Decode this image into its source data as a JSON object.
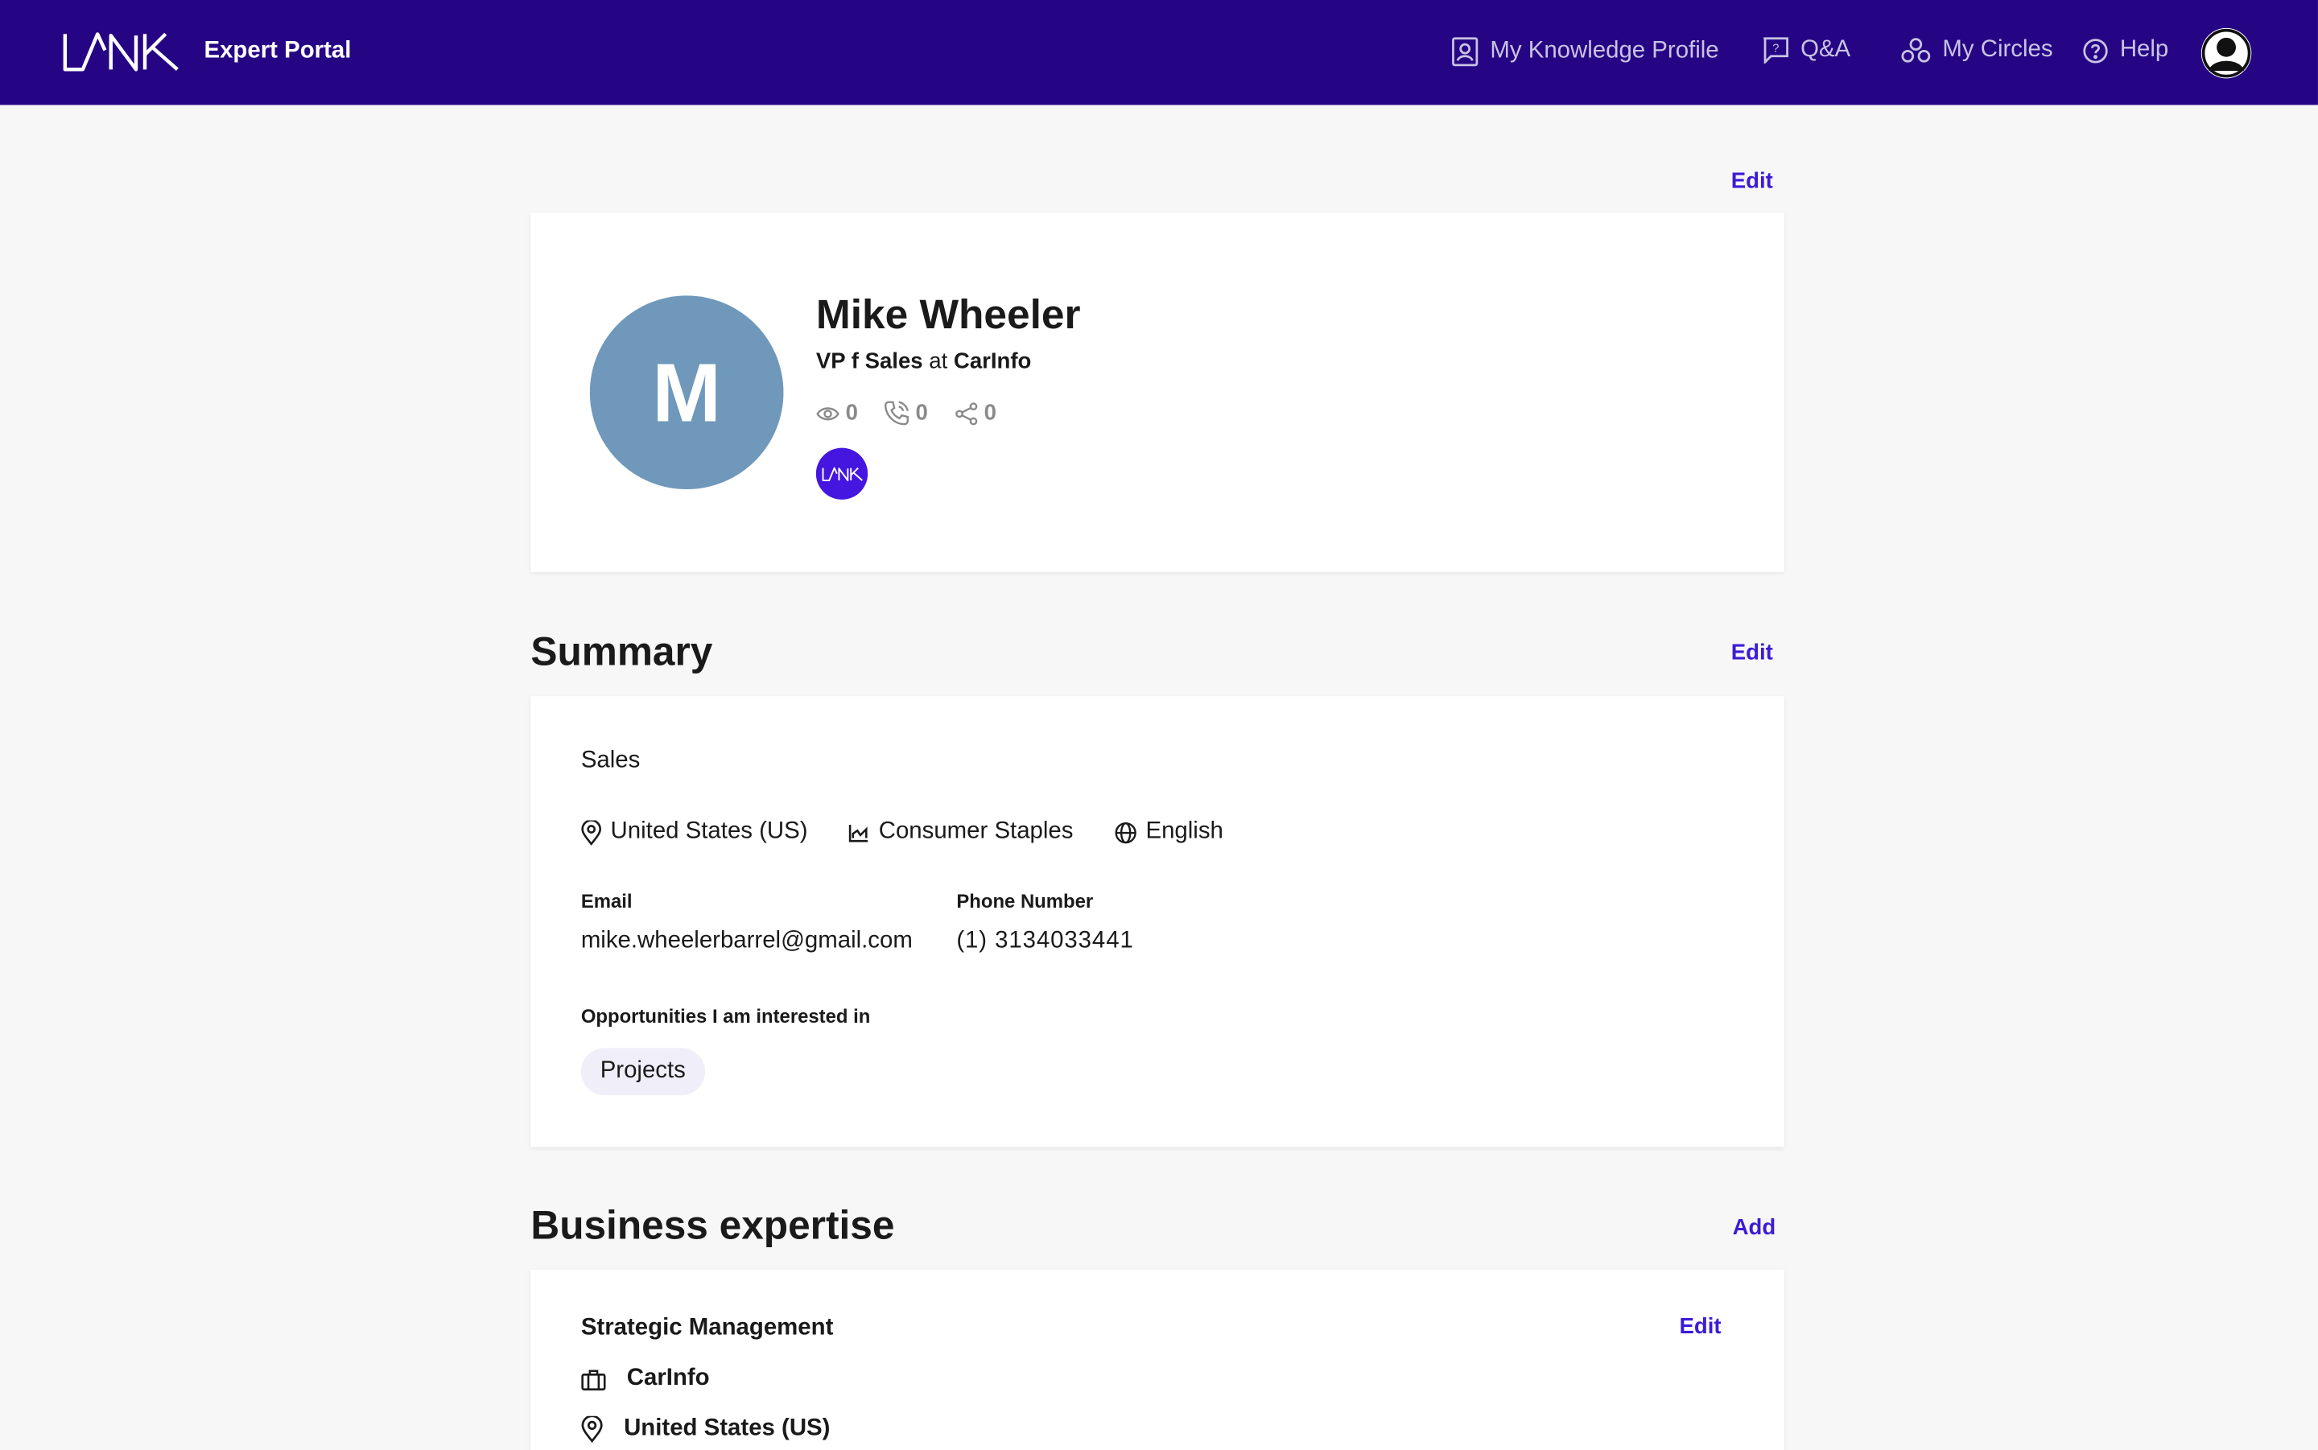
{
  "header": {
    "portal_title": "Expert Portal",
    "nav": [
      {
        "label": "My Knowledge Profile",
        "icon": "profile-icon"
      },
      {
        "label": "Q&A",
        "icon": "qa-icon"
      },
      {
        "label": "My Circles",
        "icon": "circles-icon"
      },
      {
        "label": "Help",
        "icon": "help-icon"
      }
    ]
  },
  "profile": {
    "edit_label": "Edit",
    "avatar_letter": "M",
    "name": "Mike Wheeler",
    "title": "VP f Sales",
    "at": "at",
    "company": "CarInfo",
    "stats": {
      "views": "0",
      "calls": "0",
      "shares": "0"
    }
  },
  "summary": {
    "heading": "Summary",
    "edit_label": "Edit",
    "function": "Sales",
    "location": "United States (US)",
    "industry": "Consumer Staples",
    "language": "English",
    "email_label": "Email",
    "email": "mike.wheelerbarrel@gmail.com",
    "phone_label": "Phone Number",
    "phone": "(1) 3134033441",
    "opportunities_label": "Opportunities I am interested in",
    "opportunities": [
      "Projects"
    ]
  },
  "expertise": {
    "heading": "Business expertise",
    "add_label": "Add",
    "items": [
      {
        "title": "Strategic Management",
        "edit_label": "Edit",
        "company": "CarInfo",
        "location": "United States (US)"
      }
    ]
  },
  "colors": {
    "header_bg": "#260585",
    "accent": "#3d1bd6",
    "avatar_bg": "#6f98bb"
  }
}
